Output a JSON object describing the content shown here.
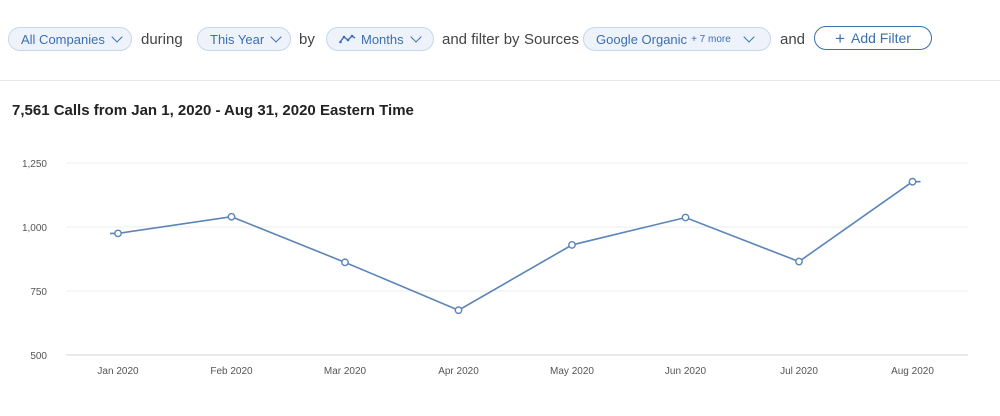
{
  "filters": {
    "companies": "All Companies",
    "during": "during",
    "period": "This Year",
    "by": "by",
    "interval": "Months",
    "filter_by": "and filter by",
    "sources_label": "Sources",
    "source": "Google Organic",
    "source_more": "+ 7 more",
    "and": "and",
    "add_filter": "Add Filter"
  },
  "chart_data": {
    "type": "line",
    "title": "7,561 Calls from Jan 1, 2020 - Aug 31, 2020 Eastern Time",
    "categories": [
      "Jan 2020",
      "Feb 2020",
      "Mar 2020",
      "Apr 2020",
      "May 2020",
      "Jun 2020",
      "Jul 2020",
      "Aug 2020"
    ],
    "series": [
      {
        "values": [
          975,
          1040,
          862,
          675,
          930,
          1037,
          865,
          1177
        ]
      }
    ],
    "yticks": [
      "500",
      "750",
      "1,000",
      "1,250"
    ],
    "ylim": [
      500,
      1250
    ],
    "grid": true,
    "color": "#5b84b8"
  }
}
